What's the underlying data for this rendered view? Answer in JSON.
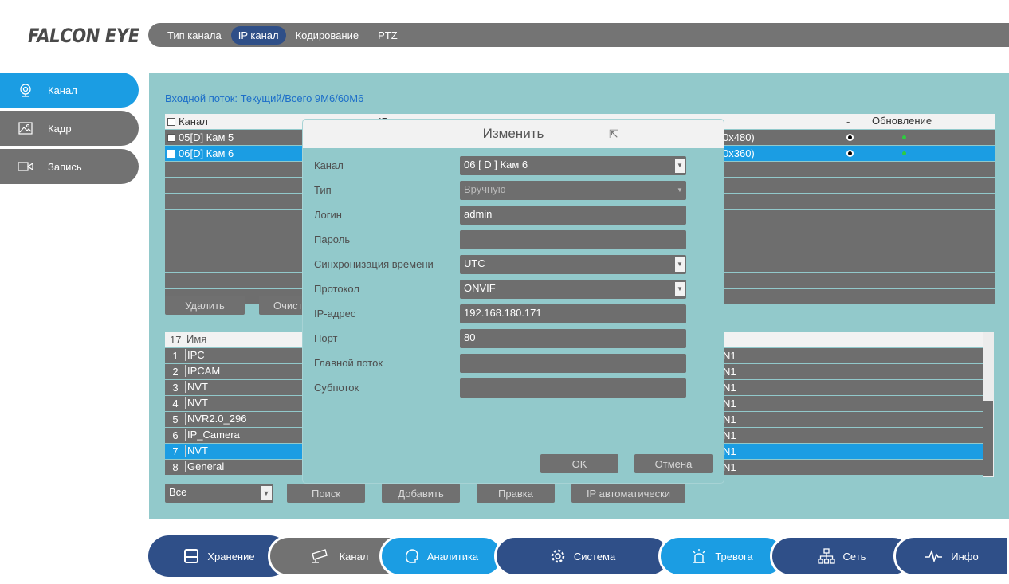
{
  "logo": "FALCON EYE",
  "top_tabs": [
    "Тип канала",
    "IP канал",
    "Кодирование",
    "PTZ"
  ],
  "left_menu": [
    {
      "label": "Канал",
      "icon": "camera-lens-icon",
      "active": true
    },
    {
      "label": "Кадр",
      "icon": "image-icon",
      "active": false
    },
    {
      "label": "Запись",
      "icon": "record-icon",
      "active": false
    }
  ],
  "stream_info": "Входной поток: Текущий/Всего 9M6/60M6",
  "channel_table": {
    "headers": {
      "channel": "Канал",
      "col_ip": "IP",
      "col_dash": "-",
      "update": "Обновление"
    },
    "rows": [
      {
        "channel": "05[D] Кам 5",
        "resolution": "0x480)",
        "selected": false
      },
      {
        "channel": "06[D] Кам 6",
        "resolution": "0x360)",
        "selected": true
      }
    ]
  },
  "buttons_mid": {
    "delete": "Удалить",
    "clear": "Очист"
  },
  "device_table": {
    "count": "17",
    "name_header": "Имя",
    "rows": [
      {
        "n": "1",
        "name": "IPC",
        "proto": "N1"
      },
      {
        "n": "2",
        "name": "IPCAM",
        "proto": "N1"
      },
      {
        "n": "3",
        "name": "NVT",
        "proto": "N1"
      },
      {
        "n": "4",
        "name": "NVT",
        "proto": "N1"
      },
      {
        "n": "5",
        "name": "NVR2.0_296",
        "proto": "N1"
      },
      {
        "n": "6",
        "name": "IP_Camera",
        "proto": "N1"
      },
      {
        "n": "7",
        "name": "NVT",
        "proto": "N1",
        "selected": true
      },
      {
        "n": "8",
        "name": "General",
        "proto": "N1"
      }
    ]
  },
  "filter_select": "Все",
  "bottom_buttons": {
    "search": "Поиск",
    "add": "Добавить",
    "edit": "Правка",
    "auto_ip": "IP автоматически"
  },
  "modal": {
    "title": "Изменить",
    "fields": {
      "channel_label": "Канал",
      "channel_value": "06 [ D ] Кам 6",
      "type_label": "Тип",
      "type_value": "Вручную",
      "login_label": "Логин",
      "login_value": "admin",
      "password_label": "Пароль",
      "password_value": "",
      "timesync_label": "Синхронизация времени",
      "timesync_value": "UTC",
      "protocol_label": "Протокол",
      "protocol_value": "ONVIF",
      "ip_label": "IP-адрес",
      "ip_value": "192.168.180.171",
      "port_label": "Порт",
      "port_value": "80",
      "mainstream_label": "Главной поток",
      "mainstream_value": "",
      "substream_label": "Субпоток",
      "substream_value": ""
    },
    "ok": "OK",
    "cancel": "Отмена"
  },
  "bottom_nav": [
    {
      "label": "Хранение",
      "icon": "storage-icon",
      "color": "#2f4f88"
    },
    {
      "label": "Канал",
      "icon": "cctv-camera-icon",
      "color": "#727272"
    },
    {
      "label": "Аналитика",
      "icon": "analytics-icon",
      "color": "#1b9de3"
    },
    {
      "label": "Система",
      "icon": "gear-icon",
      "color": "#2f4f88"
    },
    {
      "label": "Тревога",
      "icon": "alarm-icon",
      "color": "#1b9de3"
    },
    {
      "label": "Сеть",
      "icon": "network-icon",
      "color": "#2f4f88"
    },
    {
      "label": "Инфо",
      "icon": "pulse-icon",
      "color": "#2f4f88"
    }
  ]
}
